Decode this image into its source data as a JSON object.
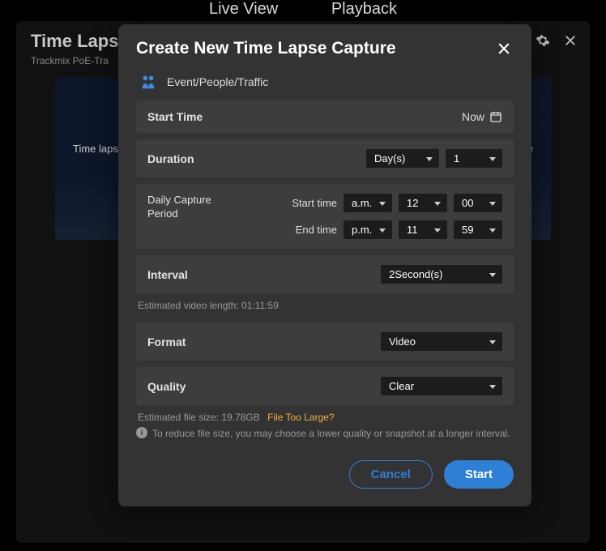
{
  "topnav": {
    "live": "Live View",
    "playback": "Playback"
  },
  "back": {
    "title": "Time Laps",
    "subtitle": "Trackmix PoE-Tra",
    "caption_left": "Time laps",
    "caption_right": "g and the"
  },
  "modal": {
    "title": "Create New Time Lapse Capture",
    "mode_label": "Event/People/Traffic",
    "start_time": {
      "label": "Start Time",
      "value": "Now"
    },
    "duration": {
      "label": "Duration",
      "unit": "Day(s)",
      "count": "1"
    },
    "period": {
      "label": "Daily Capture Period",
      "start_label": "Start time",
      "end_label": "End time",
      "start_ampm": "a.m.",
      "start_hour": "12",
      "start_min": "00",
      "end_ampm": "p.m.",
      "end_hour": "11",
      "end_min": "59"
    },
    "interval": {
      "label": "Interval",
      "value": "2Second(s)"
    },
    "est_length": "Estimated video length: 01:11:59",
    "format": {
      "label": "Format",
      "value": "Video"
    },
    "quality": {
      "label": "Quality",
      "value": "Clear"
    },
    "est_size_prefix": "Estimated file size: 19.78GB",
    "warn": "File Too Large?",
    "info": "To reduce file size, you may choose a lower quality or snapshot at a longer interval.",
    "cancel": "Cancel",
    "start": "Start"
  }
}
